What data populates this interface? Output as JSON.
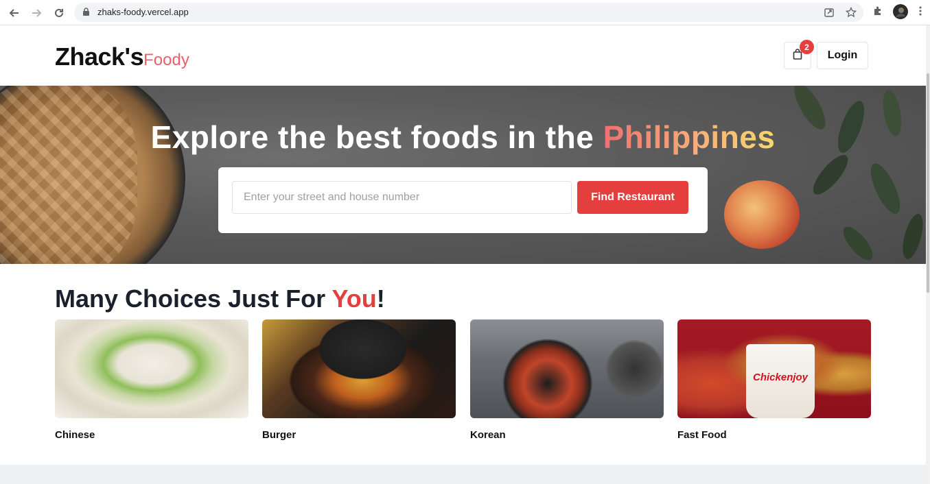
{
  "browser": {
    "url": "zhaks-foody.vercel.app"
  },
  "header": {
    "logo_main": "Zhack's",
    "logo_sub": "Foody",
    "cart_count": "2",
    "login_label": "Login"
  },
  "hero": {
    "title_prefix": "Explore the best foods in the ",
    "title_accent": "Philippines",
    "search_placeholder": "Enter your street and house number",
    "find_label": "Find Restaurant"
  },
  "choices": {
    "title_prefix": "Many Choices Just For ",
    "title_accent": "You",
    "title_suffix": "!",
    "items": [
      {
        "label": "Chinese"
      },
      {
        "label": "Burger"
      },
      {
        "label": "Korean"
      },
      {
        "label": "Fast Food"
      }
    ],
    "fastfood_brand": "Chickenjoy"
  },
  "colors": {
    "accent": "#e53e3e",
    "logo_sub": "#e8606a"
  }
}
